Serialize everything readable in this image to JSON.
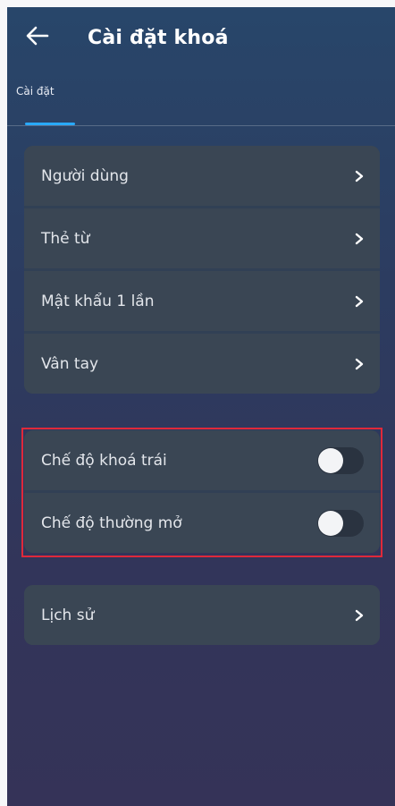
{
  "header": {
    "title": "Cài đặt khoá",
    "back_icon": "arrow-left-icon"
  },
  "tabs": [
    {
      "label": "Cài đặt",
      "active": true
    }
  ],
  "colors": {
    "accent": "#29a9ff",
    "highlight": "#e0293a",
    "card": "#3a4654"
  },
  "menu_group_1": [
    {
      "label": "Người dùng",
      "icon": "chevron-right-icon"
    },
    {
      "label": "Thẻ từ",
      "icon": "chevron-right-icon"
    },
    {
      "label": "Mật khẩu 1 lần",
      "icon": "chevron-right-icon"
    },
    {
      "label": "Vân tay",
      "icon": "chevron-right-icon"
    }
  ],
  "toggle_group": [
    {
      "label": "Chế độ khoá trái",
      "on": false
    },
    {
      "label": "Chế độ thường mở",
      "on": false
    }
  ],
  "menu_group_2": [
    {
      "label": "Lịch sử",
      "icon": "chevron-right-icon"
    }
  ]
}
